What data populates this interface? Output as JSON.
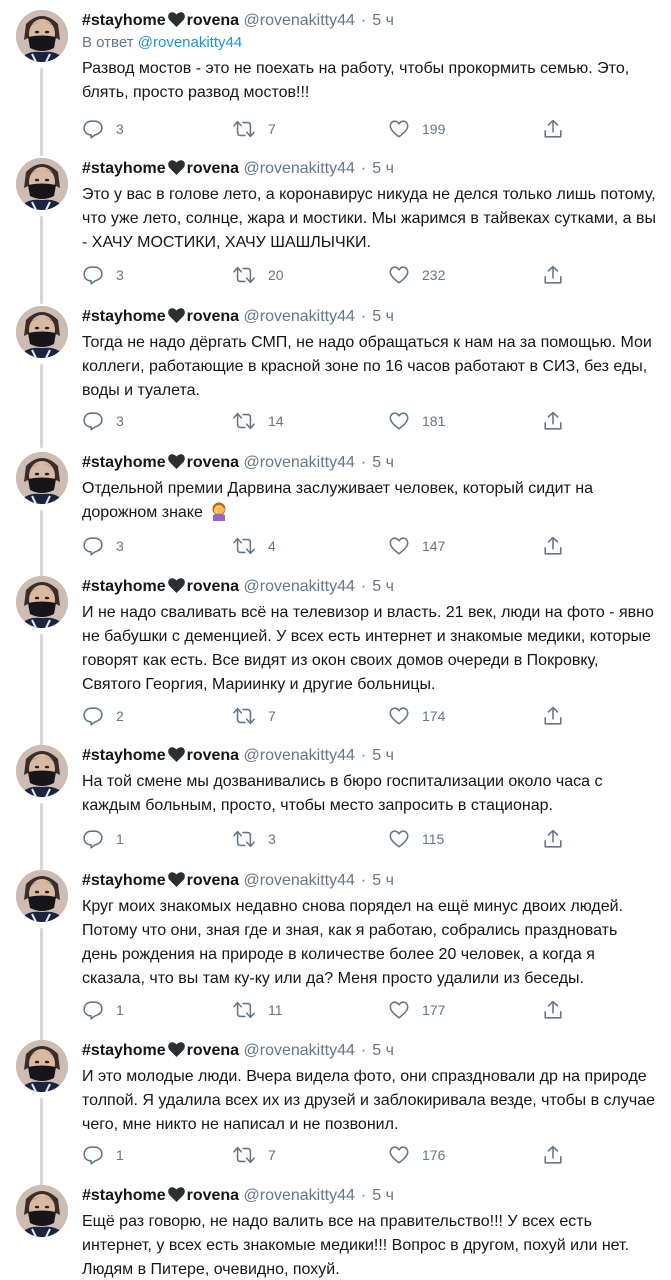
{
  "thread": {
    "display_name": "#stayhome♥rovena",
    "name_part1": "#stayhome",
    "name_part2": "rovena",
    "handle": "@rovenakitty44",
    "time": "5 ч",
    "reply_prefix": "В ответ",
    "reply_mention": "@rovenakitty44",
    "colors": {
      "thread_line": "#cfd9de",
      "heart": "#292f33",
      "link": "#1b95e0",
      "muted": "#657786"
    },
    "tweets": [
      {
        "text": "Развод мостов - это не поехать на работу, чтобы прокормить семью. Это, блять, просто развод мостов!!!",
        "replies": "3",
        "retweets": "7",
        "likes": "199"
      },
      {
        "text": "Это у вас в голове лето, а коронавирус никуда не делся только лишь потому, что уже лето, солнце, жара и мостики. Мы жаримся в тайвеках сутками, а вы - ХАЧУ МОСТИКИ, ХАЧУ ШАШЛЫЧКИ.",
        "replies": "3",
        "retweets": "20",
        "likes": "232"
      },
      {
        "text": "Тогда не надо дёргать СМП, не надо обращаться к нам на за помощью. Мои коллеги, работающие в красной зоне по 16 часов работают в СИЗ, без еды, воды и туалета.",
        "replies": "3",
        "retweets": "14",
        "likes": "181"
      },
      {
        "text": "Отдельной премии Дарвина заслуживает человек, который сидит на дорожном знаке",
        "replies": "3",
        "retweets": "4",
        "likes": "147"
      },
      {
        "text": "И не надо сваливать всё на телевизор и власть. 21 век, люди на фото - явно не бабушки с деменцией. У всех есть интернет и знакомые медики, которые говорят как есть. Все видят из окон своих домов очереди в Покровку, Святого Георгия, Мариинку и другие больницы.",
        "replies": "2",
        "retweets": "7",
        "likes": "174"
      },
      {
        "text": "На той смене мы дозванивались в бюро госпитализации около часа с каждым больным, просто, чтобы место запросить в стационар.",
        "replies": "1",
        "retweets": "3",
        "likes": "115"
      },
      {
        "text": "Круг моих знакомых недавно снова порядел на ещё минус двоих людей. Потому что они, зная где и зная, как я работаю, собрались праздновать день рождения на природе в количестве более 20 человек, а когда я сказала, что вы там ку-ку или да? Меня просто удалили из беседы.",
        "replies": "1",
        "retweets": "11",
        "likes": "177"
      },
      {
        "text": "И это молодые люди. Вчера видела фото, они спраздновали др на природе толпой. Я удалила всех их из друзей и заблокиривала везде, чтобы в случае чего, мне никто не написал и не позвонил.",
        "replies": "1",
        "retweets": "7",
        "likes": "176"
      },
      {
        "text": "Ещё раз говорю, не надо валить все на правительство!!! У всех есть интернет, у всех есть знакомые медики!!! Вопрос в другом, похуй или нет. Людям в Питере, очевидно, похуй."
      }
    ]
  },
  "icons": {
    "reply": "reply-icon",
    "retweet": "retweet-icon",
    "like": "like-icon",
    "share": "share-icon",
    "heart_emoji": "black-heart-icon",
    "facepalm_emoji": "woman-facepalming-icon"
  }
}
